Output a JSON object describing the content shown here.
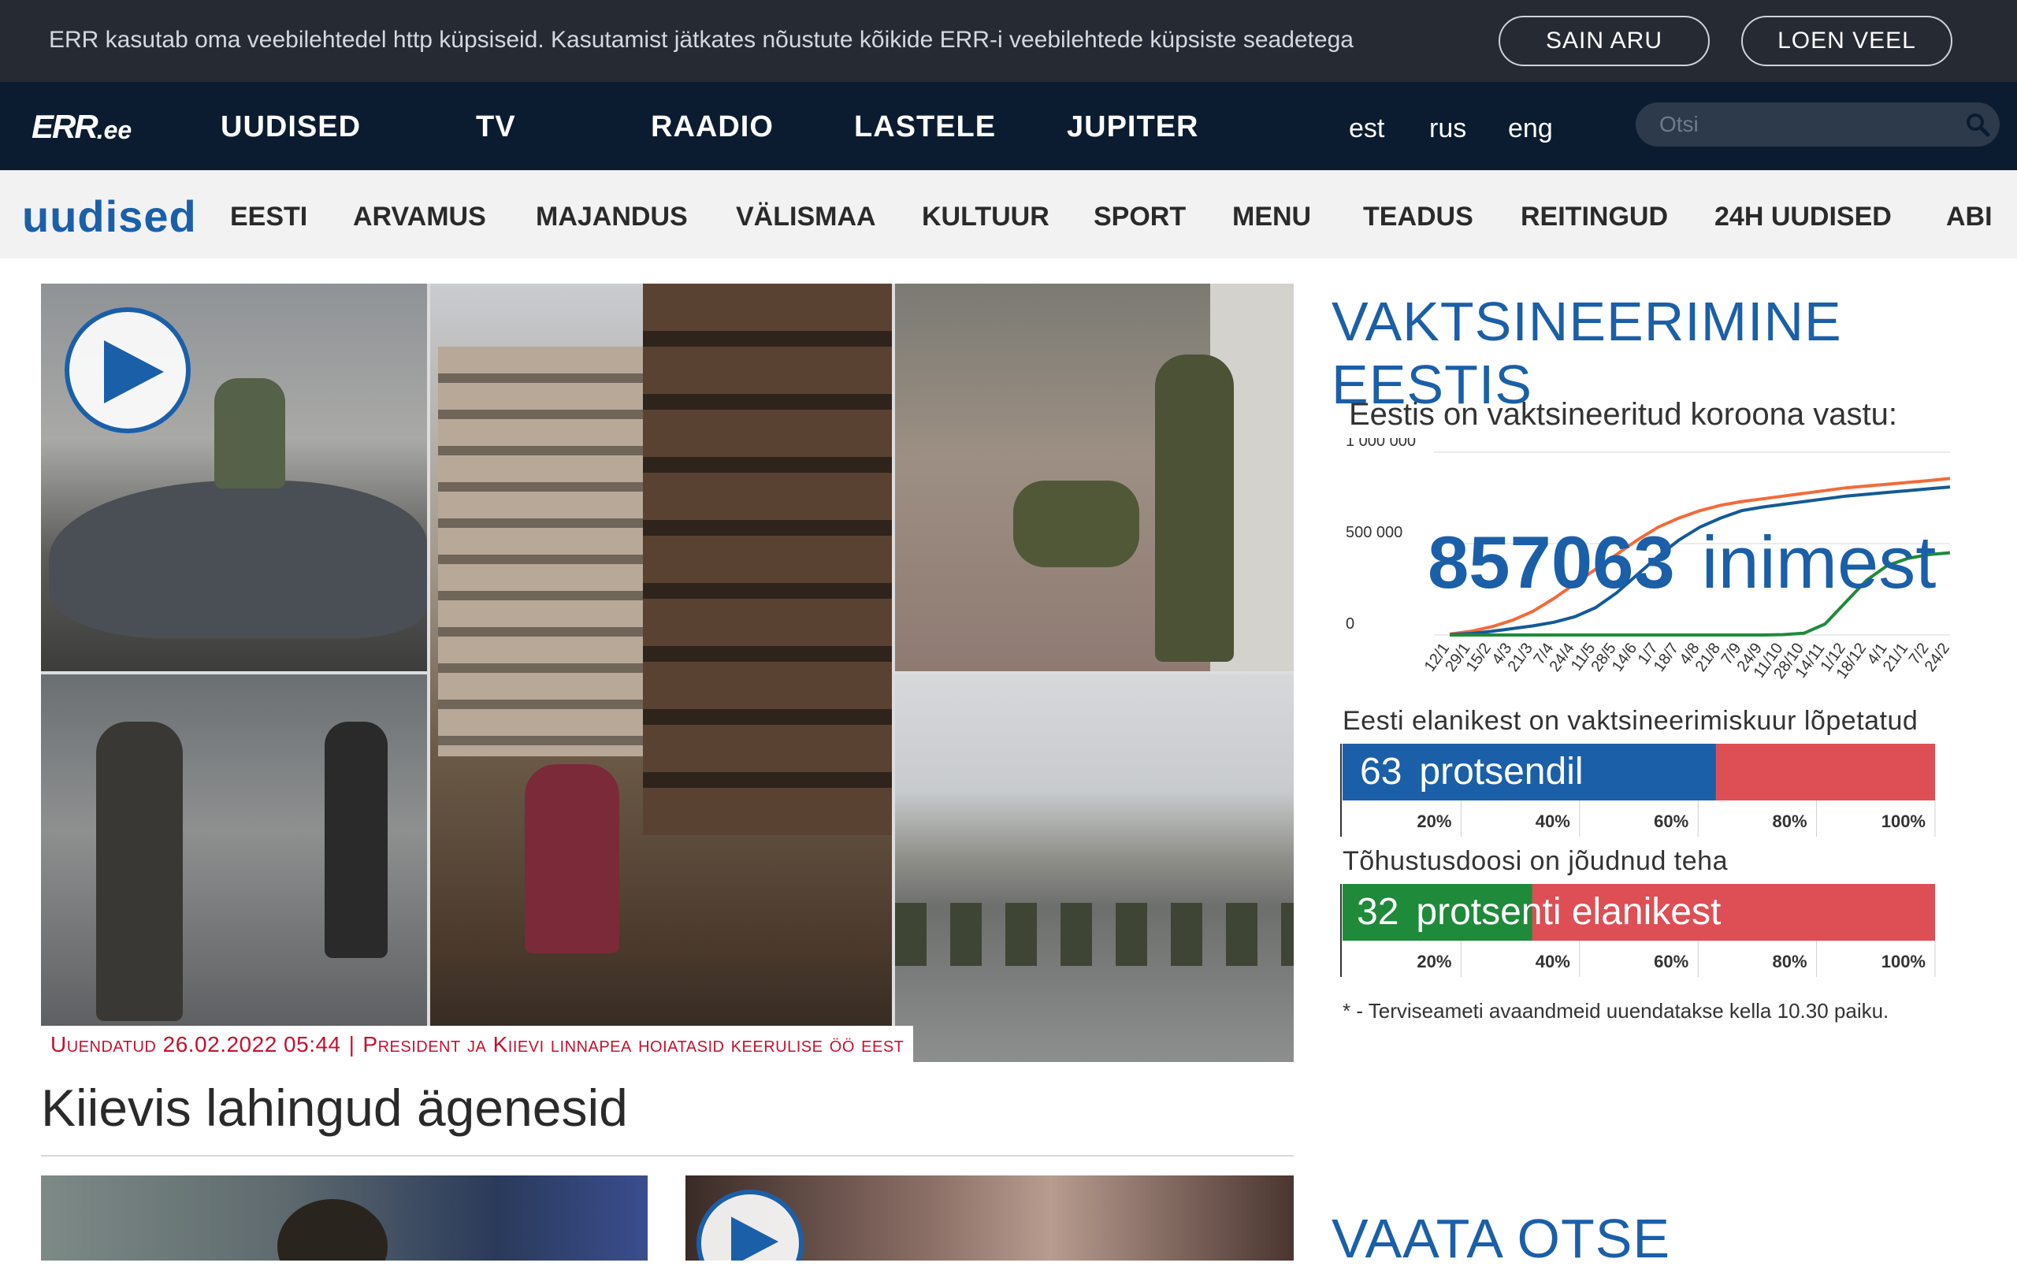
{
  "cookie": {
    "text": "ERR kasutab oma veebilehtedel http küpsiseid. Kasutamist jätkates nõustute kõikide ERR-i veebilehtede küpsiste seadetega",
    "accept": "SAIN ARU",
    "more": "LOEN VEEL"
  },
  "logo": {
    "main": "ERR",
    "suffix": ".ee"
  },
  "topnav": [
    "UUDISED",
    "TV",
    "RAADIO",
    "LASTELE",
    "JUPITER"
  ],
  "langs": [
    "est",
    "rus",
    "eng"
  ],
  "search": {
    "placeholder": "Otsi"
  },
  "subnav": {
    "brand": "uudised",
    "items": [
      "EESTI",
      "ARVAMUS",
      "MAJANDUS",
      "VÄLISMAA",
      "KULTUUR",
      "SPORT",
      "MENU",
      "TEADUS",
      "REITINGUD",
      "24H UUDISED",
      "ABI"
    ]
  },
  "hero": {
    "updated": "Uuendatud 26.02.2022 05:44",
    "separator": "|",
    "caption": "President ja Kiievi linnapea hoiatasid keerulise öö eest",
    "headline": "Kiievis lahingud ägenesid"
  },
  "vaccination": {
    "title": "VAKTSINEERIMINE EESTIS",
    "subtitle": "Eestis on vaktsineeritud koroona vastu:",
    "count": "857063",
    "count_unit": "inimest",
    "completed_title": "Eesti elanikest on vaktsineerimiskuur lõpetatud",
    "completed_value": "63",
    "completed_unit": "protsendil",
    "booster_title": "Tõhustusdoosi on jõudnud teha",
    "booster_value": "32",
    "booster_unit": "protsenti elanikest",
    "footnote": "* - Terviseameti avaandmeid uuendatakse kella 10.30 paiku.",
    "colors": {
      "blue": "#1b5fa8",
      "orange": "#f26b3a",
      "green": "#1f8a3a",
      "red": "#dd4f55",
      "navy": "#145a97"
    }
  },
  "watch_live": "VAATA OTSE",
  "chart_data": [
    {
      "type": "line",
      "title": "",
      "x": [
        "12/1",
        "29/1",
        "15/2",
        "4/3",
        "21/3",
        "7/4",
        "24/4",
        "11/5",
        "28/5",
        "14/6",
        "1/7",
        "18/7",
        "4/8",
        "21/8",
        "7/9",
        "24/9",
        "11/10",
        "28/10",
        "14/11",
        "1/12",
        "18/12",
        "4/1",
        "21/1",
        "7/2",
        "24/2"
      ],
      "ylim": [
        0,
        1000000
      ],
      "yticks": [
        "0",
        "500 000",
        "1 000 000"
      ],
      "series": [
        {
          "values": [
            5000,
            20000,
            45000,
            80000,
            130000,
            200000,
            280000,
            360000,
            440000,
            520000,
            590000,
            640000,
            680000,
            710000,
            730000,
            745000,
            760000,
            775000,
            790000,
            805000,
            815000,
            825000,
            835000,
            845000,
            857063
          ]
        },
        {
          "values": [
            2000,
            8000,
            20000,
            35000,
            50000,
            70000,
            100000,
            150000,
            230000,
            330000,
            430000,
            520000,
            590000,
            640000,
            680000,
            700000,
            715000,
            730000,
            745000,
            760000,
            770000,
            780000,
            790000,
            800000,
            810000
          ]
        },
        {
          "values": [
            0,
            0,
            0,
            0,
            0,
            0,
            0,
            0,
            0,
            0,
            0,
            0,
            0,
            0,
            0,
            0,
            2000,
            10000,
            60000,
            180000,
            300000,
            380000,
            420000,
            440000,
            450000
          ]
        }
      ]
    },
    {
      "type": "bar",
      "title": "Eesti elanikest on vaktsineerimiskuur lõpetatud",
      "categories": [
        "lõpetatud"
      ],
      "values": [
        63
      ],
      "ylim": [
        0,
        100
      ],
      "ticks": [
        "20%",
        "40%",
        "60%",
        "80%",
        "100%"
      ]
    },
    {
      "type": "bar",
      "title": "Tõhustusdoosi on jõudnud teha",
      "categories": [
        "tõhustusdoos"
      ],
      "values": [
        32
      ],
      "ylim": [
        0,
        100
      ],
      "ticks": [
        "20%",
        "40%",
        "60%",
        "80%",
        "100%"
      ]
    }
  ]
}
